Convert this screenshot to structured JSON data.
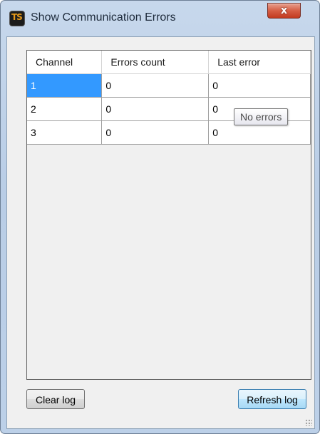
{
  "window": {
    "title": "Show Communication Errors",
    "close_label": "x",
    "icon": "ts-app-icon"
  },
  "grid": {
    "columns": [
      "Channel",
      "Errors count",
      "Last error"
    ],
    "rows": [
      [
        "1",
        "0",
        "0"
      ],
      [
        "2",
        "0",
        "0"
      ],
      [
        "3",
        "0",
        "0"
      ]
    ],
    "selected_cell": "1"
  },
  "tooltip": {
    "text": "No errors"
  },
  "buttons": {
    "clear_label": "Clear log",
    "refresh_label": "Refresh log"
  },
  "colors": {
    "selection": "#3399ff",
    "close_button": "#c23a1f",
    "window_frame": "#b9cde6"
  }
}
